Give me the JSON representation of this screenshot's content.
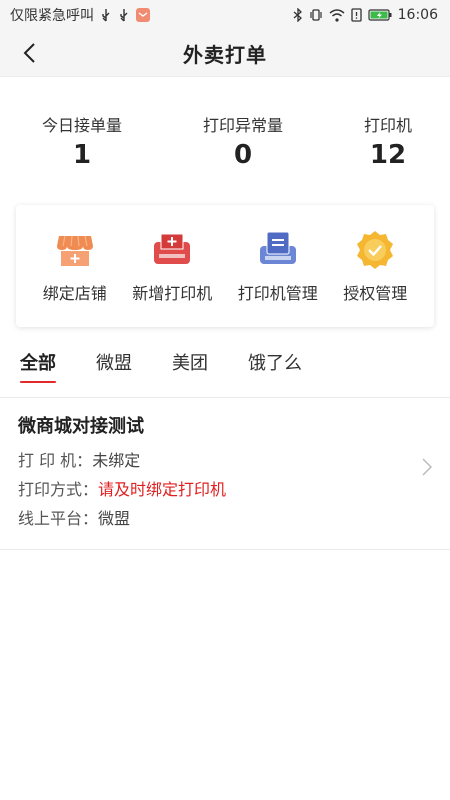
{
  "status_bar": {
    "carrier_text": "仅限紧急呼叫",
    "time": "16:06"
  },
  "header": {
    "title": "外卖打单"
  },
  "stats": [
    {
      "label": "今日接单量",
      "value": "1"
    },
    {
      "label": "打印异常量",
      "value": "0"
    },
    {
      "label": "打印机",
      "value": "12"
    }
  ],
  "actions": [
    {
      "label": "绑定店铺",
      "icon": "store-icon"
    },
    {
      "label": "新增打印机",
      "icon": "printer-add-icon"
    },
    {
      "label": "打印机管理",
      "icon": "printer-manage-icon"
    },
    {
      "label": "授权管理",
      "icon": "auth-badge-icon"
    }
  ],
  "tabs": [
    {
      "label": "全部",
      "active": true
    },
    {
      "label": "微盟",
      "active": false
    },
    {
      "label": "美团",
      "active": false
    },
    {
      "label": "饿了么",
      "active": false
    }
  ],
  "store": {
    "name": "微商城对接测试",
    "rows": [
      {
        "label": "打 印 机：",
        "value": "未绑定"
      },
      {
        "label": "打印方式：",
        "value": "请及时绑定打印机"
      },
      {
        "label": "线上平台：",
        "value": "微盟"
      }
    ]
  },
  "colors": {
    "accent_red": "#e02020",
    "store_orange": "#f08c52",
    "printer_red": "#e04b4b",
    "manage_blue": "#6b86d4",
    "badge_gold": "#f5b731"
  }
}
